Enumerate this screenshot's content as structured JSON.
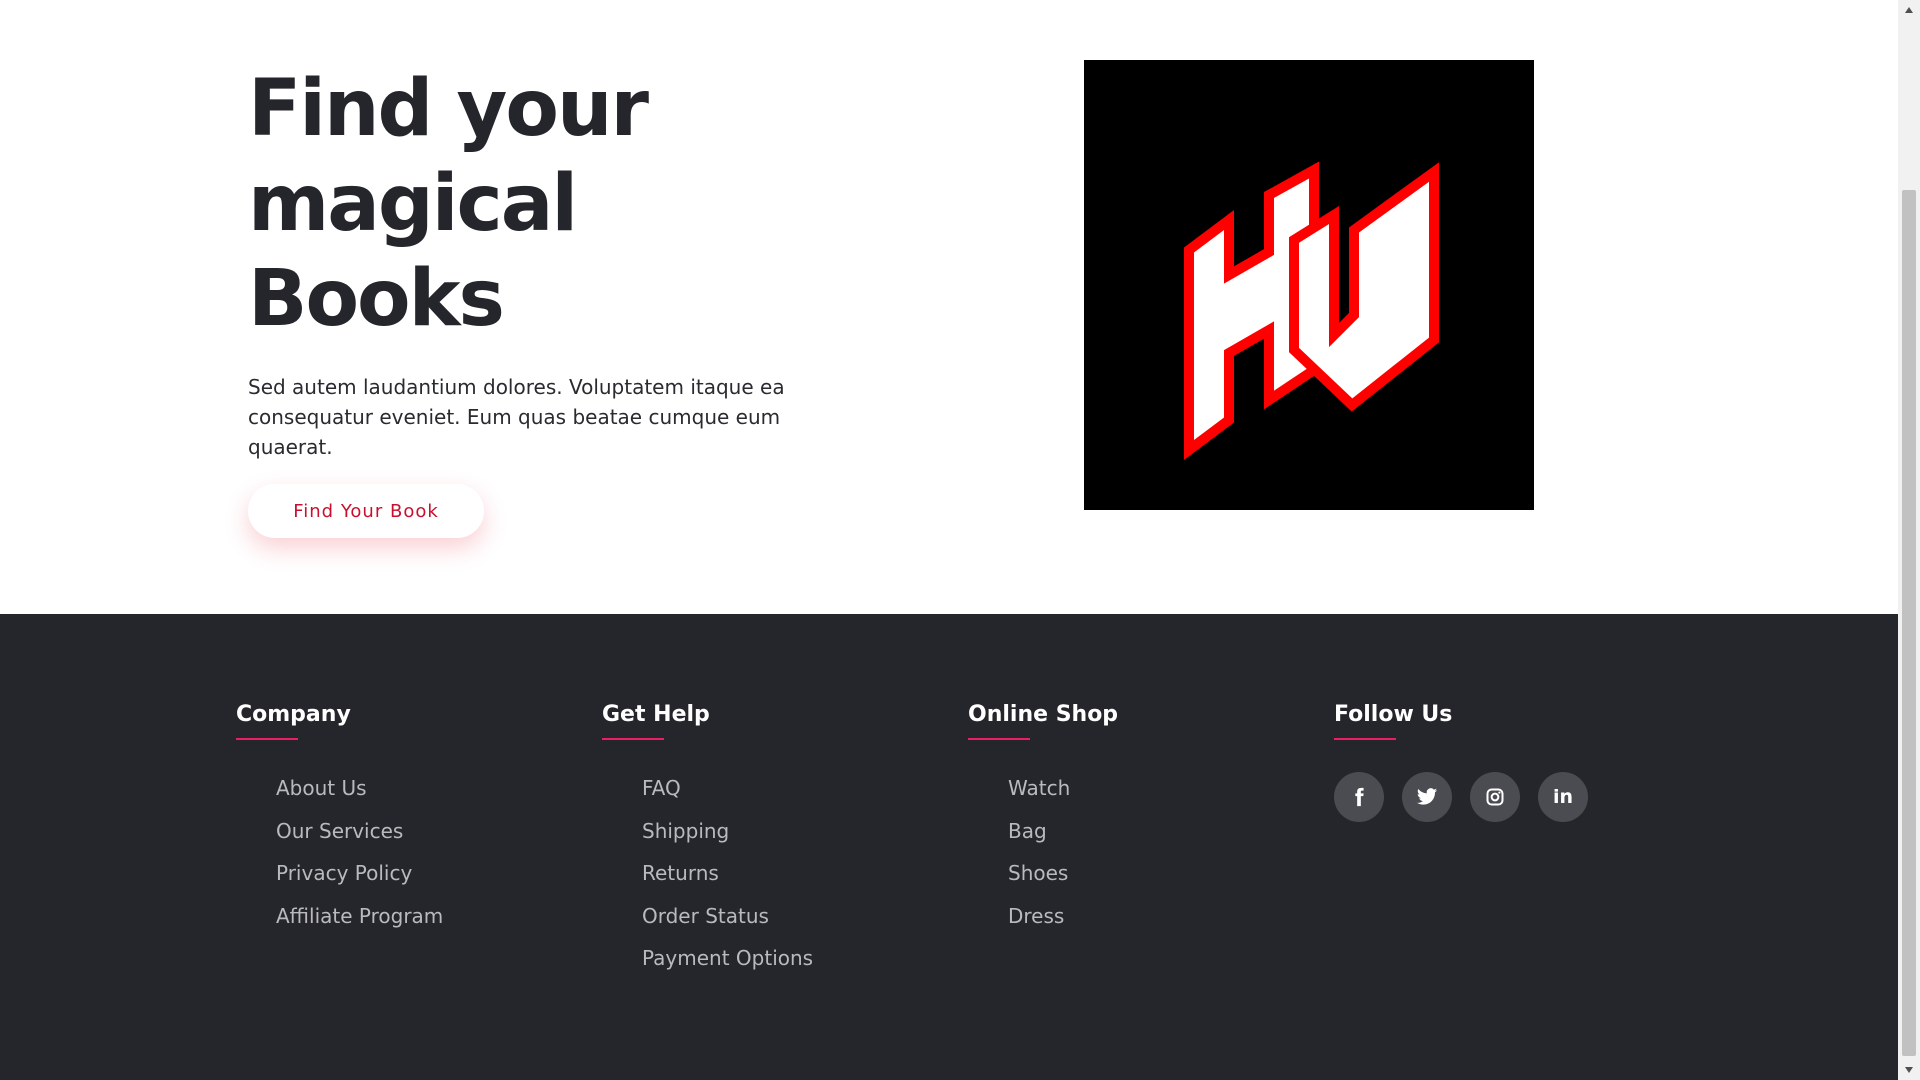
{
  "hero": {
    "title": "Find your magical Books",
    "description": "Sed autem laudantium dolores. Voluptatem itaque ea consequatur eveniet. Eum quas beatae cumque eum quaerat.",
    "cta_label": "Find Your Book",
    "logo_text": "HV",
    "colors": {
      "title": "#25262b",
      "cta_text": "#c8102e",
      "logo_bg": "#000000",
      "logo_red": "#ff0000"
    }
  },
  "footer": {
    "columns": [
      {
        "heading": "Company",
        "links": [
          "About Us",
          "Our Services",
          "Privacy Policy",
          "Affiliate Program"
        ]
      },
      {
        "heading": "Get Help",
        "links": [
          "FAQ",
          "Shipping",
          "Returns",
          "Order Status",
          "Payment Options"
        ]
      },
      {
        "heading": "Online Shop",
        "links": [
          "Watch",
          "Bag",
          "Shoes",
          "Dress"
        ]
      }
    ],
    "follow": {
      "heading": "Follow Us",
      "icons": [
        "facebook-icon",
        "twitter-icon",
        "instagram-icon",
        "linkedin-icon"
      ],
      "linkedin_text": "in"
    },
    "colors": {
      "background": "#25262b",
      "accent": "#e91e63",
      "link": "#b9babd",
      "social_bg": "#4b4c51"
    }
  }
}
